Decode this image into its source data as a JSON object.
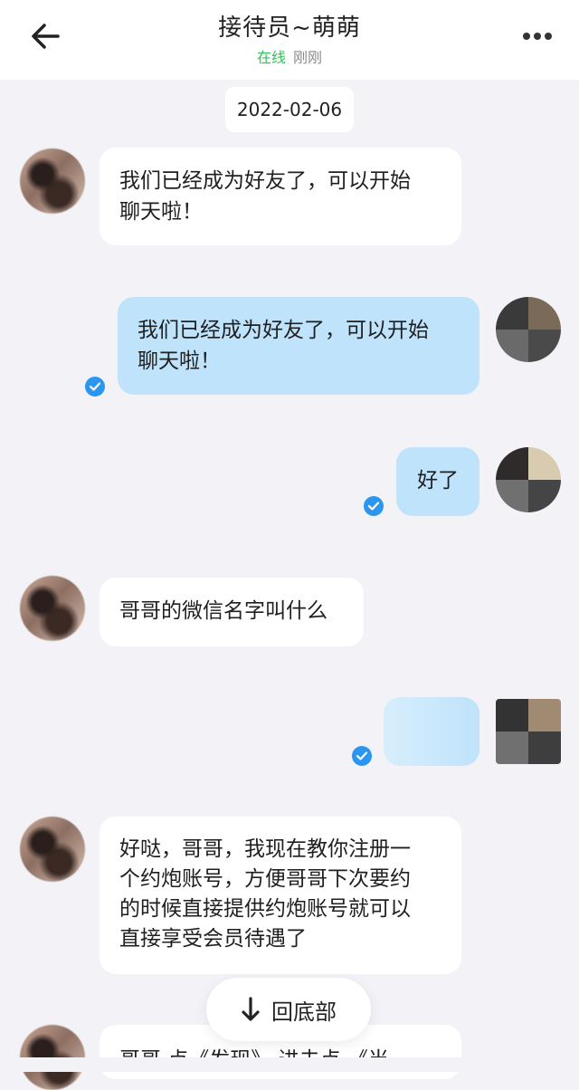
{
  "header": {
    "title": "接待员~萌萌",
    "status_online": "在线",
    "status_time": "刚刚",
    "back_icon": "arrow-left-icon",
    "more_icon": "more-dots-icon"
  },
  "date_chip": "2022-02-06",
  "messages": [
    {
      "side": "left",
      "text": "我们已经成为好友了，可以开始\n聊天啦！"
    },
    {
      "side": "right",
      "text": "我们已经成为好友了，可以开始\n聊天啦！",
      "read": true
    },
    {
      "side": "right",
      "text": "好了",
      "read": true
    },
    {
      "side": "left",
      "text": "哥哥的微信名字叫什么"
    },
    {
      "side": "right",
      "text": "",
      "read": true
    },
    {
      "side": "left",
      "text": "好哒，哥哥，我现在教你注册一\n个约炮账号，方便哥哥下次要约\n的时候直接提供约炮账号就可以\n直接享受会员待遇了"
    },
    {
      "side": "left",
      "text": "哥哥 点《发现》 进去点 《当"
    }
  ],
  "scroll_to_bottom": {
    "label": "回底部",
    "icon": "arrow-down-icon"
  },
  "colors": {
    "online": "#2fc25b",
    "outgoing_bubble": "#bfe3fb",
    "read_check": "#2b96f0",
    "background": "#f3f3f7"
  }
}
